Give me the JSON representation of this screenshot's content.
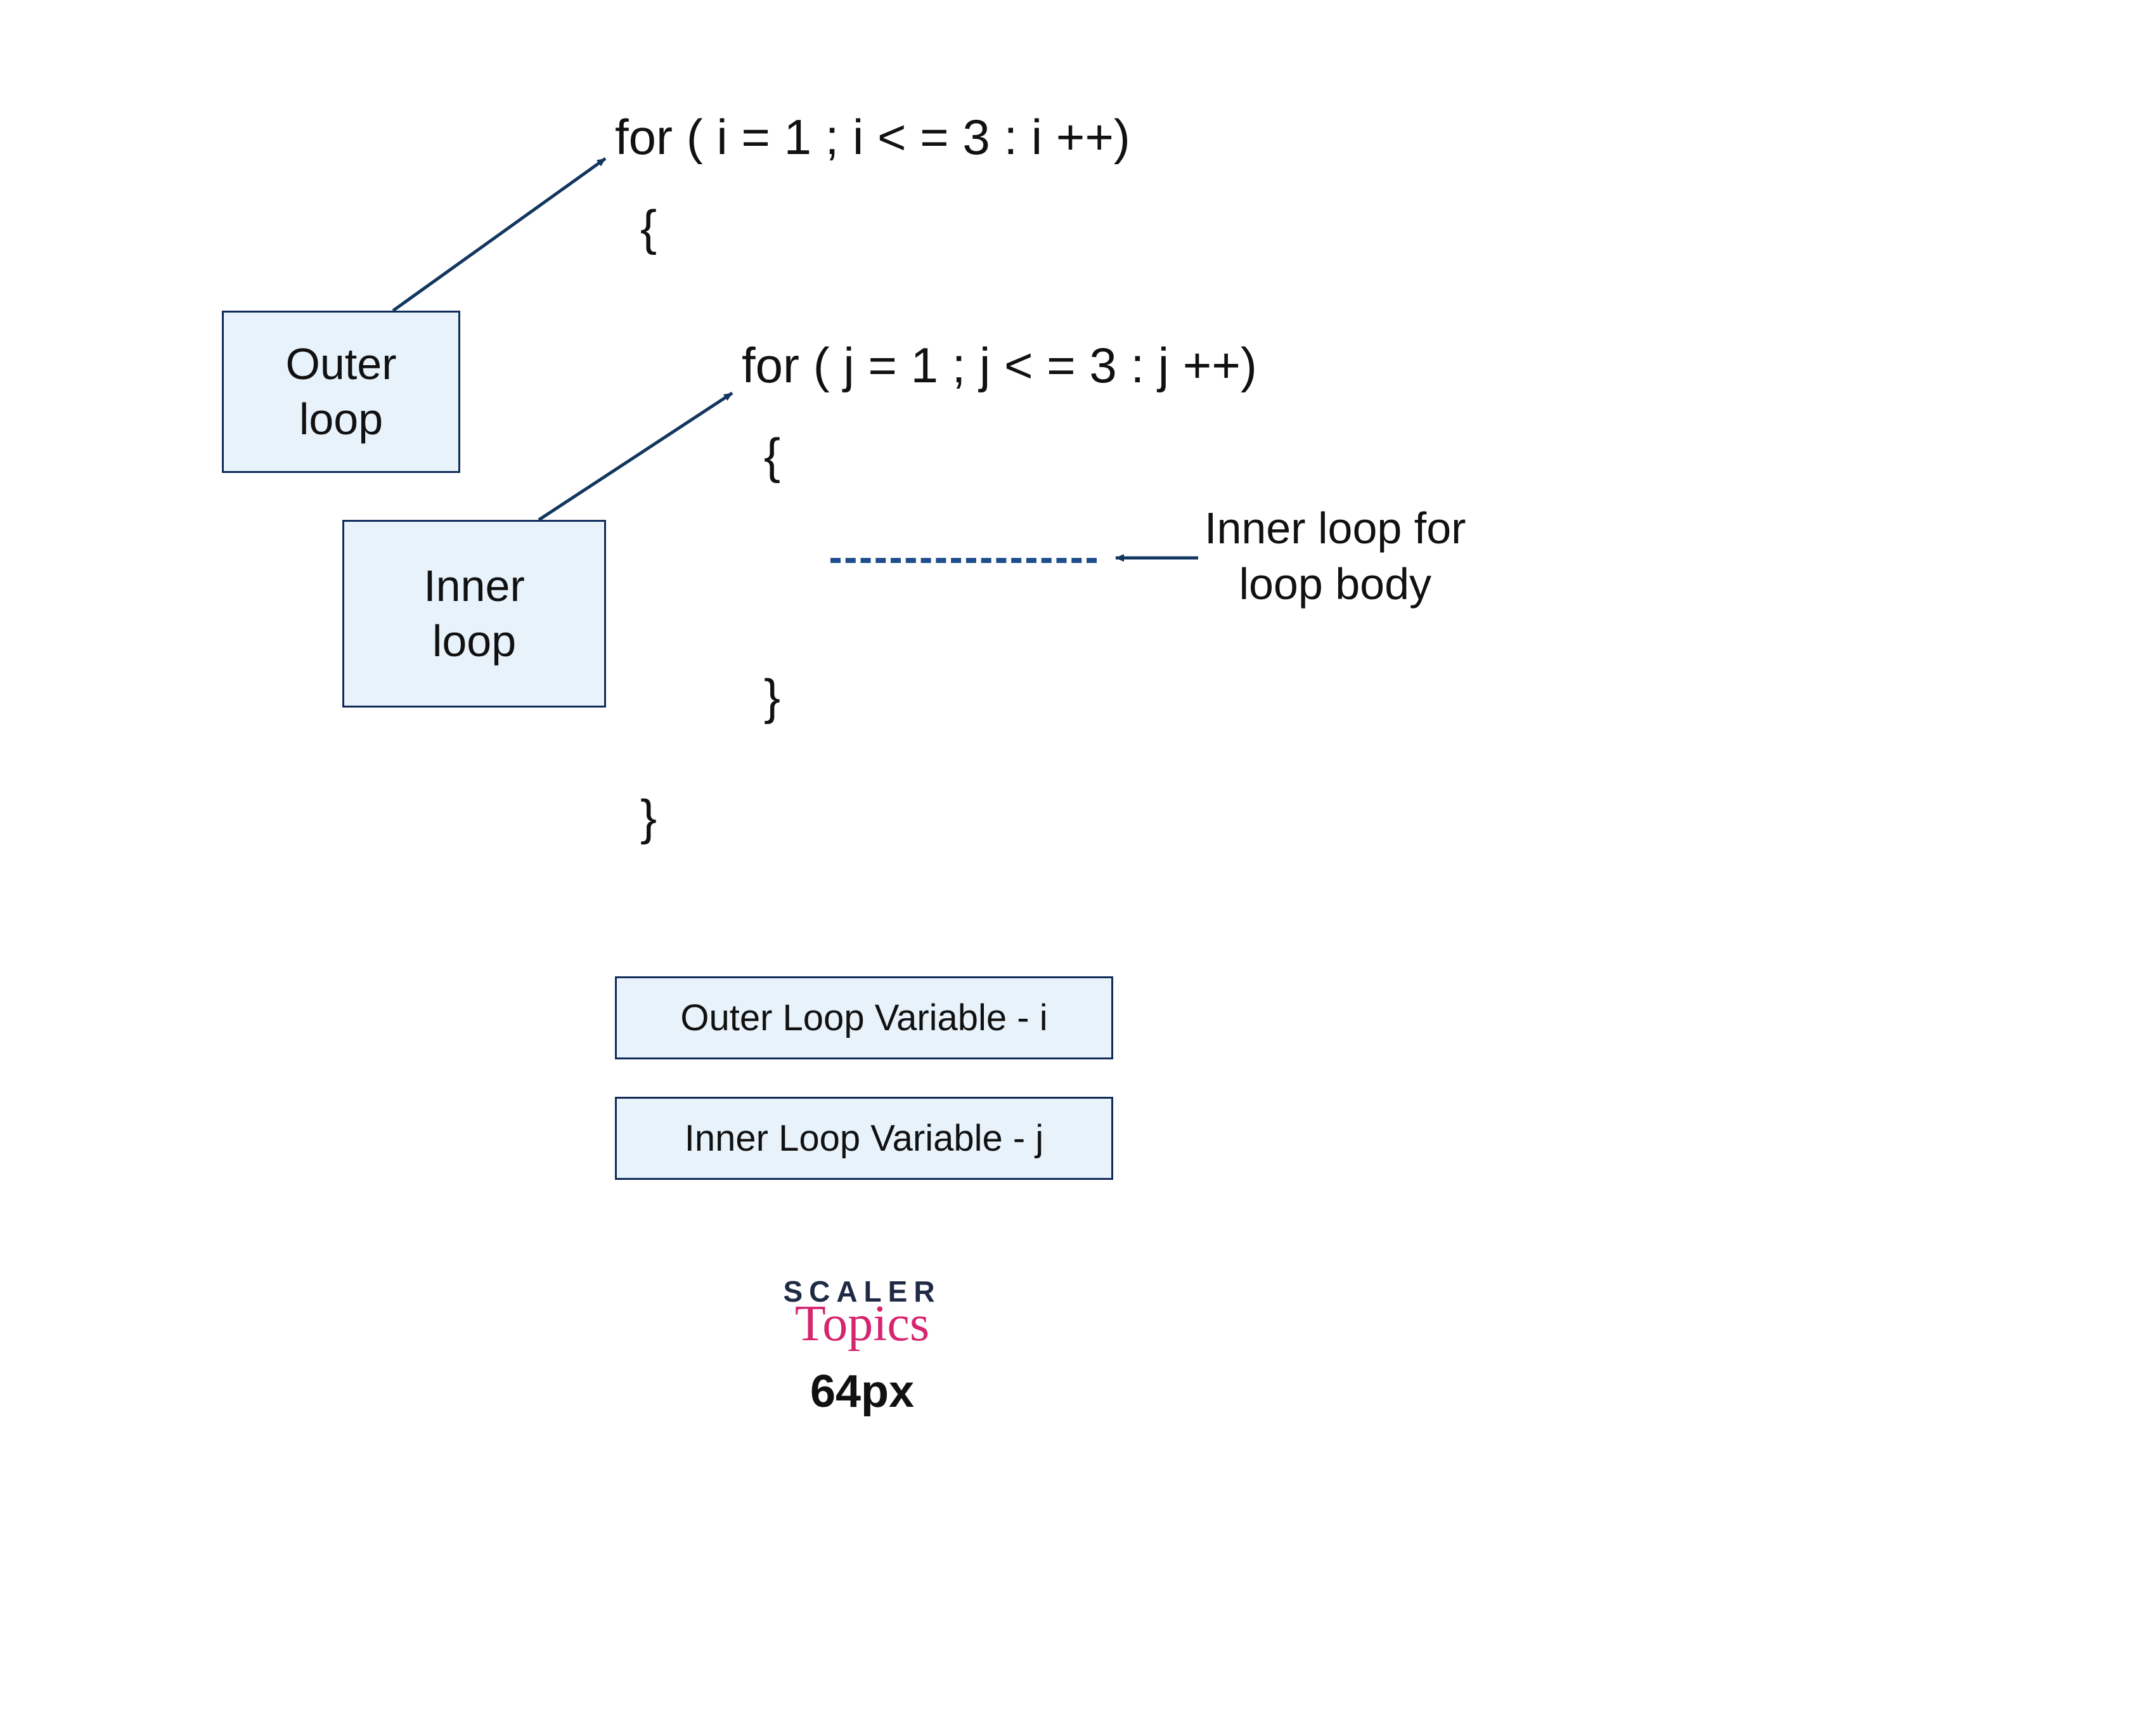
{
  "code": {
    "outer_for": "for ( i = 1 ; i < = 3 : i ++)",
    "outer_open_brace": "{",
    "inner_for": "for ( j = 1 ; j < = 3 : j ++)",
    "inner_open_brace": "{",
    "inner_close_brace": "}",
    "outer_close_brace": "}"
  },
  "labels": {
    "outer_loop_line1": "Outer",
    "outer_loop_line2": "loop",
    "inner_loop_line1": "Inner",
    "inner_loop_line2": "loop",
    "body_line1": "Inner loop for",
    "body_line2": "loop body"
  },
  "legend": {
    "outer_var": "Outer Loop Variable - i",
    "inner_var": "Inner Loop Variable - j"
  },
  "logo": {
    "top": "SCALER",
    "bottom": "Topics",
    "px": "64px"
  },
  "colors": {
    "box_fill": "#e8f2fb",
    "box_border": "#0f2c59",
    "arrow": "#12365f",
    "dash": "#1f4e8c",
    "accent": "#d6246e"
  }
}
